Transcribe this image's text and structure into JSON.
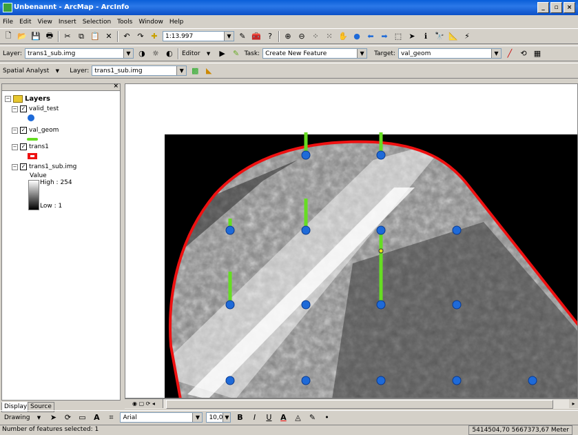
{
  "window": {
    "title": "Unbenannt - ArcMap - ArcInfo"
  },
  "menu": [
    "File",
    "Edit",
    "View",
    "Insert",
    "Selection",
    "Tools",
    "Window",
    "Help"
  ],
  "standard_toolbar": {
    "scale": "1:13.997"
  },
  "effects_toolbar": {
    "layer_label": "Layer:",
    "layer_value": "trans1_sub.img",
    "editor_label": "Editor",
    "task_label": "Task:",
    "task_value": "Create New Feature",
    "target_label": "Target:",
    "target_value": "val_geom"
  },
  "spatial_toolbar": {
    "menu_label": "Spatial Analyst",
    "layer_label": "Layer:",
    "layer_value": "trans1_sub.img"
  },
  "toc": {
    "root": "Layers",
    "layers": [
      {
        "name": "valid_test"
      },
      {
        "name": "val_geom"
      },
      {
        "name": "trans1"
      },
      {
        "name": "trans1_sub.img",
        "value_label": "Value",
        "high": "High : 254",
        "low": "Low : 1"
      }
    ],
    "tabs": [
      "Display",
      "Source"
    ]
  },
  "drawing_toolbar": {
    "drawing_label": "Drawing",
    "font": "Arial",
    "font_size": "10,0",
    "bold": "B",
    "italic": "I",
    "underline": "U"
  },
  "status": {
    "selection_text": "Number of features selected: 1",
    "coordinates": "5414504,70 5667373,67 Meter"
  },
  "colors": {
    "point": "#1e6ad8",
    "line": "#66dd22",
    "boundary": "#ee1111",
    "titlebar": "#0a5fd8"
  }
}
